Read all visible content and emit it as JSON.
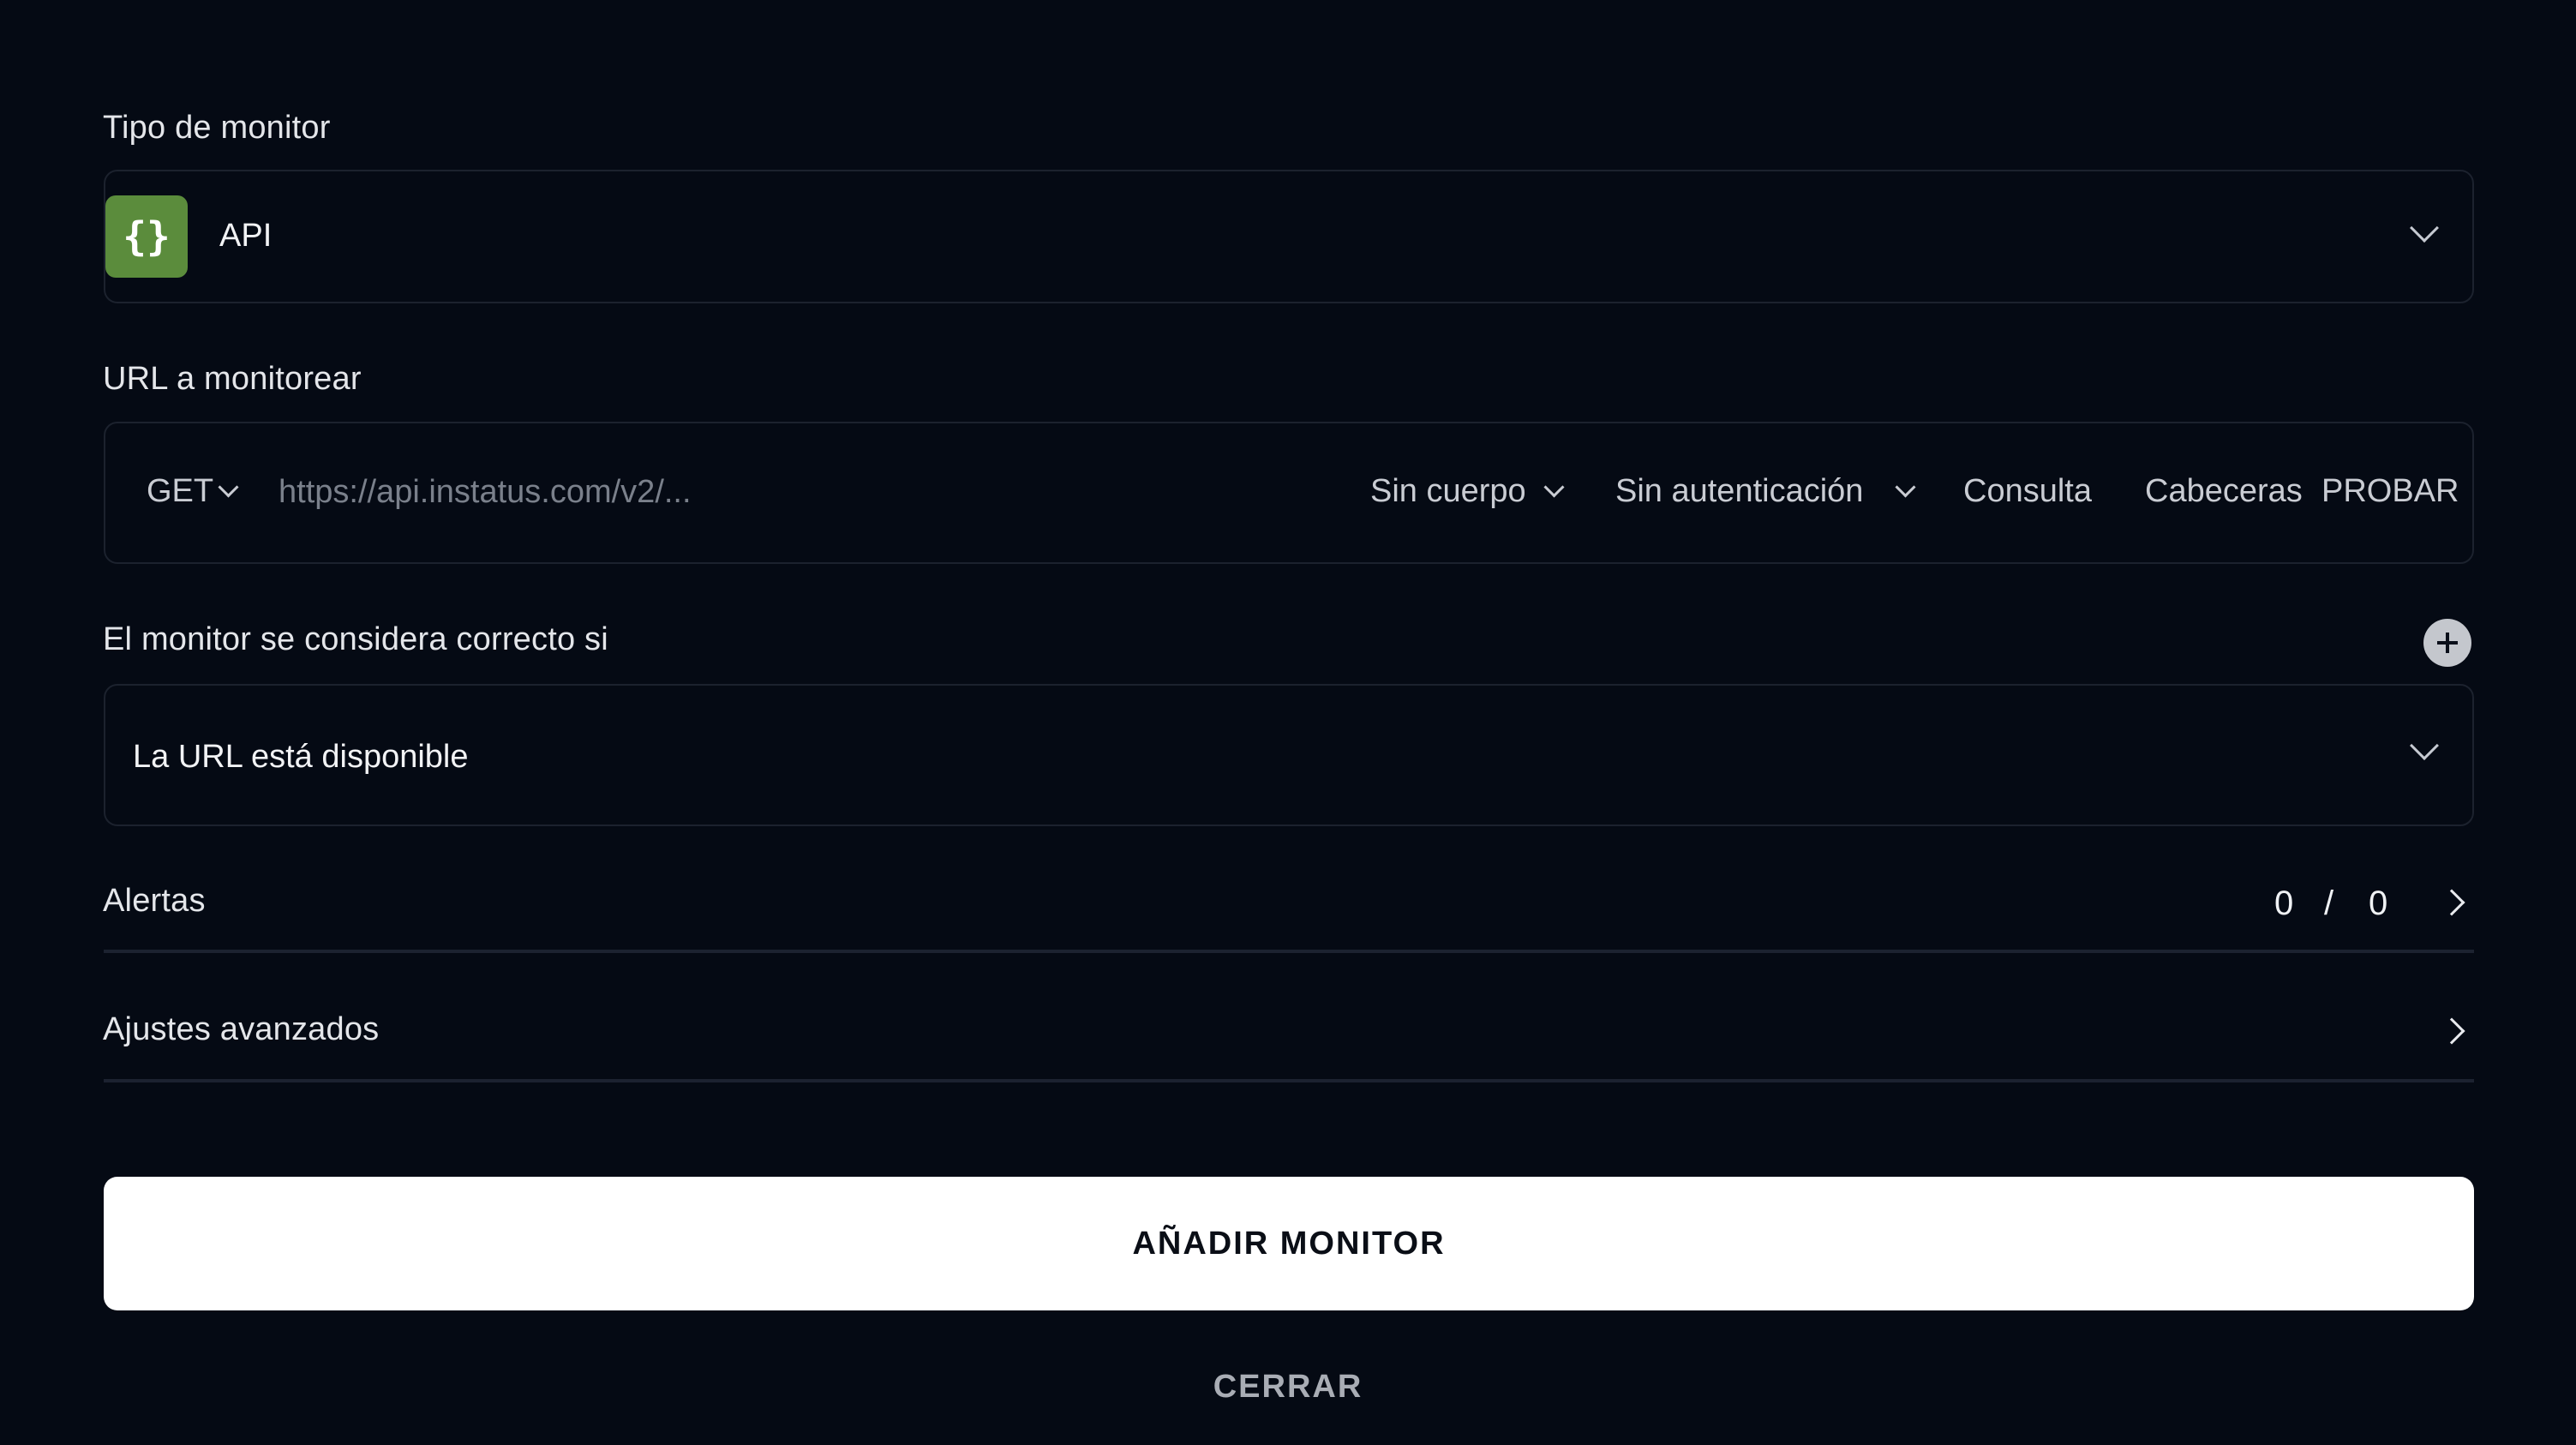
{
  "monitor_type": {
    "label": "Tipo de monitor",
    "icon": "braces-icon",
    "icon_glyph": "{}",
    "icon_color": "#5b8c3c",
    "value": "API"
  },
  "url": {
    "label": "URL a monitorear",
    "method": "GET",
    "placeholder": "https://api.instatus.com/v2/...",
    "body_option": "Sin cuerpo",
    "auth_option": "Sin autenticación",
    "query_tab": "Consulta",
    "headers_tab": "Cabeceras",
    "test_button": "PROBAR"
  },
  "condition": {
    "label": "El monitor se considera correcto si",
    "value": "La URL está disponible"
  },
  "alerts": {
    "label": "Alertas",
    "count_active": "0",
    "separator": "/",
    "count_total": "0"
  },
  "advanced": {
    "label": "Ajustes avanzados"
  },
  "actions": {
    "submit_label": "AÑADIR MONITOR",
    "close_label": "CERRAR"
  }
}
